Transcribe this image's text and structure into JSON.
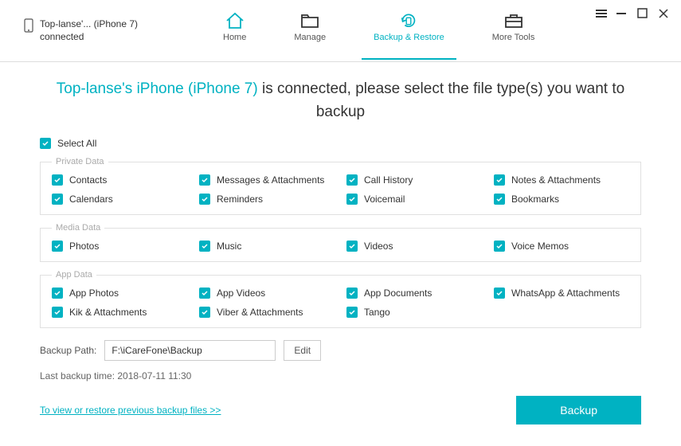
{
  "device": {
    "name": "Top-lanse'... (iPhone 7)",
    "status": "connected"
  },
  "nav": {
    "home": "Home",
    "manage": "Manage",
    "backup": "Backup & Restore",
    "tools": "More Tools"
  },
  "headline": {
    "device": "Top-lanse's iPhone (iPhone 7)",
    "suffix": " is connected, please select the file type(s) you want to backup"
  },
  "select_all": "Select All",
  "groups": {
    "private": {
      "title": "Private Data",
      "items": [
        "Contacts",
        "Messages & Attachments",
        "Call History",
        "Notes & Attachments",
        "Calendars",
        "Reminders",
        "Voicemail",
        "Bookmarks"
      ]
    },
    "media": {
      "title": "Media Data",
      "items": [
        "Photos",
        "Music",
        "Videos",
        "Voice Memos"
      ]
    },
    "app": {
      "title": "App Data",
      "items": [
        "App Photos",
        "App Videos",
        "App Documents",
        "WhatsApp & Attachments",
        "Kik & Attachments",
        "Viber & Attachments",
        "Tango"
      ]
    }
  },
  "path": {
    "label": "Backup Path:",
    "value": "F:\\iCareFone\\Backup",
    "edit": "Edit"
  },
  "last_backup": "Last backup time: 2018-07-11 11:30",
  "link": "To view or restore previous backup files >>",
  "backup_btn": "Backup"
}
